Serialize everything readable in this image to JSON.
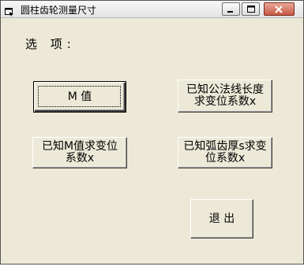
{
  "window": {
    "title": "圆柱齿轮测量尺寸",
    "icons": {
      "app": "app-icon",
      "minimize": "minimize-icon",
      "maximize": "maximize-icon",
      "close": "close-icon"
    }
  },
  "main": {
    "options_label": "选  项:",
    "buttons": {
      "m_value": "M    值",
      "known_normal_length": "已知公法线长度\n求变位系数x",
      "known_m_value": "已知M值求变位\n系数x",
      "known_arc_tooth": "已知弧齿厚s求变\n位系数x",
      "exit": "退  出"
    }
  },
  "colors": {
    "window_bg": "#ece9d8",
    "title_text": "#000000"
  }
}
